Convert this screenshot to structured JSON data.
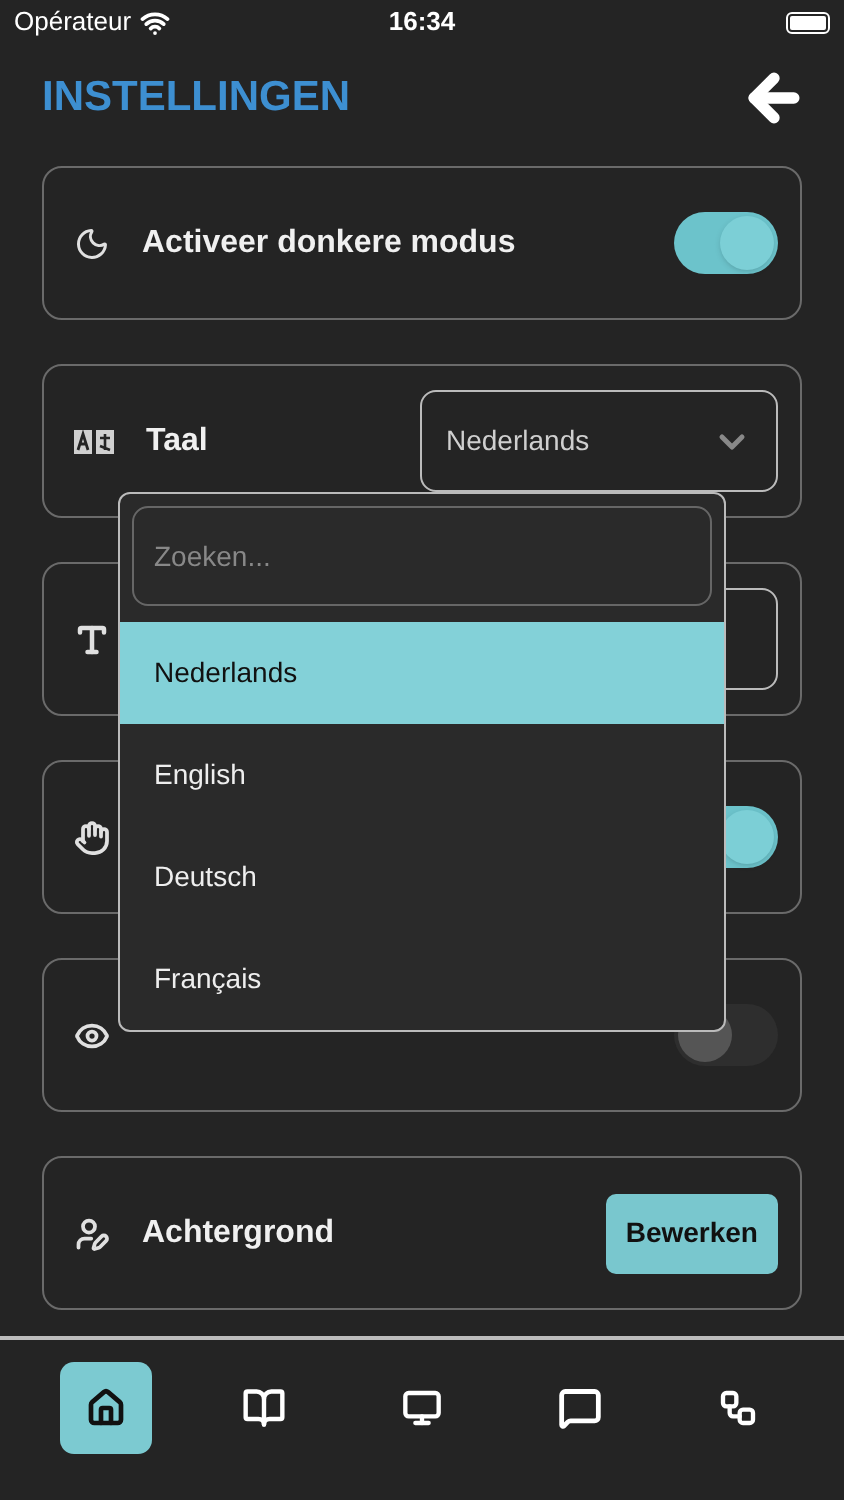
{
  "status_bar": {
    "carrier": "Opérateur",
    "time": "16:34"
  },
  "header": {
    "title": "INSTELLINGEN"
  },
  "settings": [
    {
      "kind": "toggle",
      "label": "Activeer donkere modus",
      "on": true
    },
    {
      "kind": "select",
      "label": "Taal",
      "value": "Nederlands"
    },
    {
      "kind": "select"
    },
    {
      "kind": "toggle",
      "on": true
    },
    {
      "kind": "toggle",
      "on": false
    },
    {
      "kind": "button",
      "label": "Achtergrond",
      "button": "Bewerken"
    }
  ],
  "dropdown": {
    "placeholder": "Zoeken...",
    "options": [
      {
        "label": "Nederlands",
        "selected": true
      },
      {
        "label": "English",
        "selected": false
      },
      {
        "label": "Deutsch",
        "selected": false
      },
      {
        "label": "Français",
        "selected": false
      }
    ]
  },
  "nav": [
    {
      "selected": true
    },
    {
      "selected": false
    },
    {
      "selected": false
    },
    {
      "selected": false
    },
    {
      "selected": false
    }
  ]
}
